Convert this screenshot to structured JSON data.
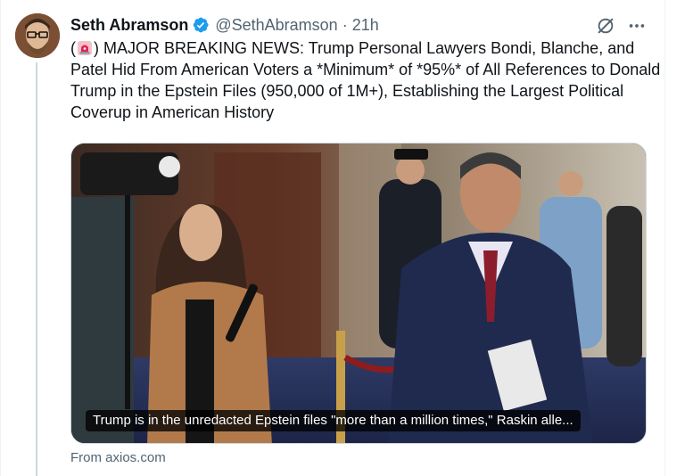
{
  "author": {
    "name": "Seth Abramson",
    "handle": "@SethAbramson",
    "separator": "·",
    "time": "21h"
  },
  "tweet": {
    "text_open": "(",
    "text_body": ") MAJOR BREAKING NEWS: Trump Personal Lawyers Bondi, Blanche, and Patel Hid From American Voters a *Minimum* of *95%* of All References to Donald Trump in the Epstein Files (950,000 of 1M+), Establishing the Largest Political Coverup in American History"
  },
  "card": {
    "caption": "Trump is in the unredacted Epstein files \"more than a million times,\" Raskin alle...",
    "source": "From axios.com"
  },
  "colors": {
    "text_primary": "#0f1419",
    "text_secondary": "#536471",
    "verified_blue": "#1d9bf0",
    "border": "#cfd9de"
  },
  "icons": [
    "verified-badge-icon",
    "grok-icon",
    "more-options-icon",
    "siren-emoji-icon"
  ]
}
